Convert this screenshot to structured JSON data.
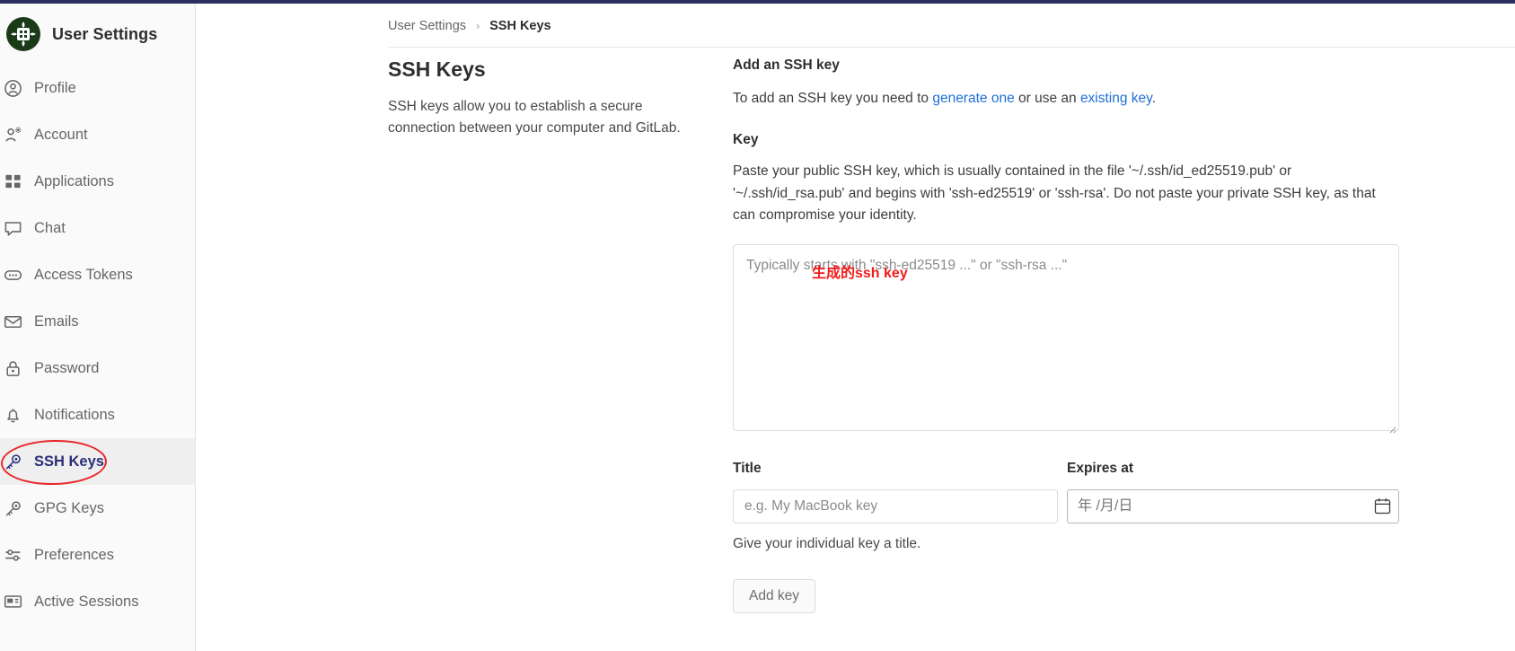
{
  "app": {
    "accent_color": "#2b2f77",
    "link_color": "#1f6fd6",
    "annotation_color": "#f21b1b",
    "brand_title": "User Settings"
  },
  "sidebar": {
    "items": [
      {
        "label": "Profile",
        "icon": "user-circle-icon",
        "active": false
      },
      {
        "label": "Account",
        "icon": "user-gear-icon",
        "active": false
      },
      {
        "label": "Applications",
        "icon": "grid-apps-icon",
        "active": false
      },
      {
        "label": "Chat",
        "icon": "chat-bubble-icon",
        "active": false
      },
      {
        "label": "Access Tokens",
        "icon": "token-pill-icon",
        "active": false
      },
      {
        "label": "Emails",
        "icon": "envelope-icon",
        "active": false
      },
      {
        "label": "Password",
        "icon": "lock-icon",
        "active": false
      },
      {
        "label": "Notifications",
        "icon": "bell-icon",
        "active": false
      },
      {
        "label": "SSH Keys",
        "icon": "key-icon",
        "active": true
      },
      {
        "label": "GPG Keys",
        "icon": "key-icon",
        "active": false
      },
      {
        "label": "Preferences",
        "icon": "sliders-icon",
        "active": false
      },
      {
        "label": "Active Sessions",
        "icon": "monitor-icon",
        "active": false
      }
    ]
  },
  "breadcrumb": {
    "parent": "User Settings",
    "separator": "›",
    "current": "SSH Keys"
  },
  "left_panel": {
    "title": "SSH Keys",
    "description": "SSH keys allow you to establish a secure connection between your computer and GitLab."
  },
  "form": {
    "heading": "Add an SSH key",
    "intro_before": "To add an SSH key you need to ",
    "intro_link1": "generate one",
    "intro_middle": " or use an ",
    "intro_link2": "existing key",
    "intro_after": ".",
    "key_label": "Key",
    "key_help": "Paste your public SSH key, which is usually contained in the file '~/.ssh/id_ed25519.pub' or '~/.ssh/id_rsa.pub' and begins with 'ssh-ed25519' or 'ssh-rsa'. Do not paste your private SSH key, as that can compromise your identity.",
    "key_placeholder": "Typically starts with \"ssh-ed25519 ...\" or \"ssh-rsa ...\"",
    "key_value": "",
    "title_label": "Title",
    "title_placeholder": "e.g. My MacBook key",
    "title_value": "",
    "title_hint": "Give your individual key a title.",
    "expires_label": "Expires at",
    "expires_placeholder": "年 /月/日",
    "expires_value": "",
    "submit_label": "Add key"
  },
  "annotations": {
    "textarea_note": "生成的ssh key",
    "sidebar_circle_target": "SSH Keys"
  }
}
